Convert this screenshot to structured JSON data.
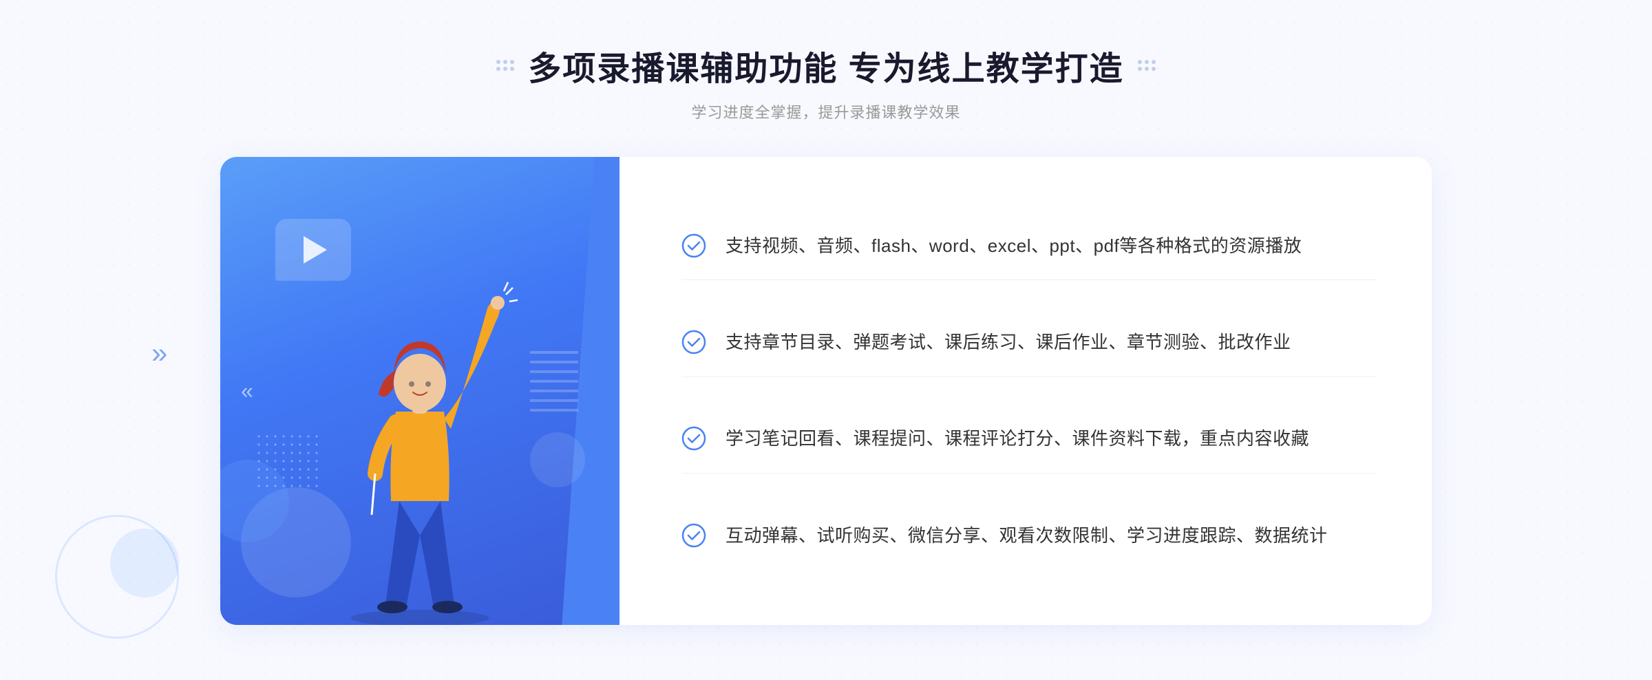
{
  "header": {
    "title": "多项录播课辅助功能 专为线上教学打造",
    "subtitle": "学习进度全掌握，提升录播课教学效果"
  },
  "features": [
    {
      "id": "feature-1",
      "text": "支持视频、音频、flash、word、excel、ppt、pdf等各种格式的资源播放"
    },
    {
      "id": "feature-2",
      "text": "支持章节目录、弹题考试、课后练习、课后作业、章节测验、批改作业"
    },
    {
      "id": "feature-3",
      "text": "学习笔记回看、课程提问、课程评论打分、课件资料下载，重点内容收藏"
    },
    {
      "id": "feature-4",
      "text": "互动弹幕、试听购买、微信分享、观看次数限制、学习进度跟踪、数据统计"
    }
  ],
  "colors": {
    "primary_blue": "#4a82f5",
    "title_dark": "#1a1a2e",
    "text_gray": "#999999",
    "feature_text": "#333333",
    "check_color": "#4a82f5"
  },
  "decorative": {
    "left_arrows": "»",
    "play_button_label": "play-icon"
  }
}
